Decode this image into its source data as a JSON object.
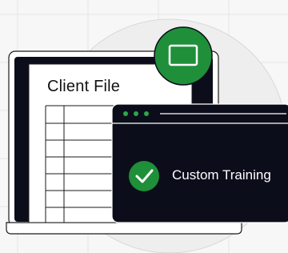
{
  "document": {
    "title": "Client File"
  },
  "card": {
    "label": "Custom Training"
  },
  "icons": {
    "monitor": "monitor-icon",
    "check": "check-icon",
    "dots": "window-dots-icon"
  },
  "colors": {
    "accent_green": "#1f8f3a",
    "dark": "#0c0d1a",
    "background": "#f7f7f7",
    "circle": "#eeeeef"
  }
}
